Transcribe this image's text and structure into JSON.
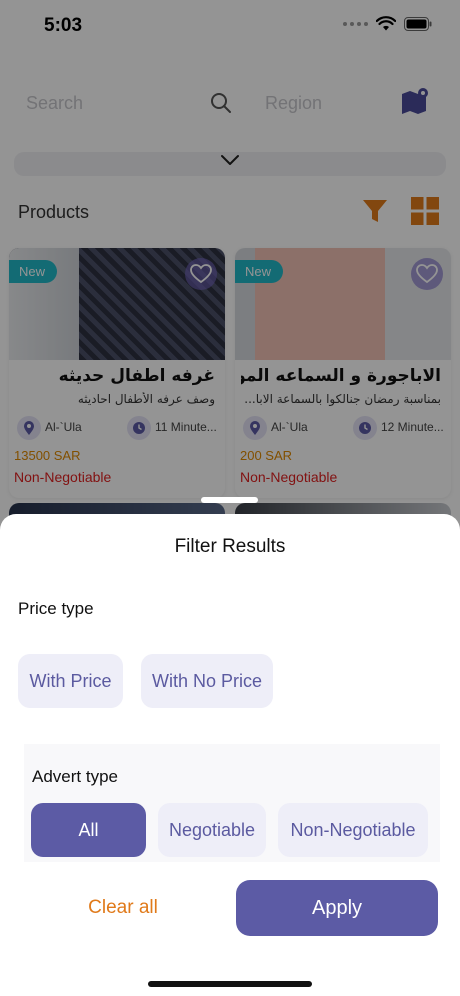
{
  "status_bar": {
    "time": "5:03"
  },
  "search": {
    "placeholder": "Search",
    "region_placeholder": "Region"
  },
  "products": {
    "title": "Products",
    "cards": [
      {
        "badge": "New",
        "title": "غرفه اطفال حديثه",
        "description": "وصف عرفه الأطفال احاديثه",
        "location": "Al-`Ula",
        "time": "11 Minute...",
        "price": "13500 SAR",
        "negotiable": "Non-Negotiable"
      },
      {
        "badge": "New",
        "title": "الاباجورة و السماعه المو...",
        "description": "بمناسبة رمضان جنالكوا بالسماعة الابا...",
        "location": "Al-`Ula",
        "time": "12 Minute...",
        "price": "200 SAR",
        "negotiable": "Non-Negotiable"
      }
    ]
  },
  "filter_sheet": {
    "title": "Filter Results",
    "price_type": {
      "label": "Price type",
      "options": [
        "With Price",
        "With No Price"
      ]
    },
    "advert_type": {
      "label": "Advert type",
      "options": [
        "All",
        "Negotiable",
        "Non-Negotiable"
      ],
      "selected": "All"
    },
    "clear_label": "Clear all",
    "apply_label": "Apply"
  },
  "colors": {
    "accent": "#5c5ba5",
    "chip_bg": "#eeeef8",
    "orange": "#e07a1a",
    "price": "#e08a00",
    "negative": "#e01f1f",
    "badge": "#21b8c9"
  }
}
